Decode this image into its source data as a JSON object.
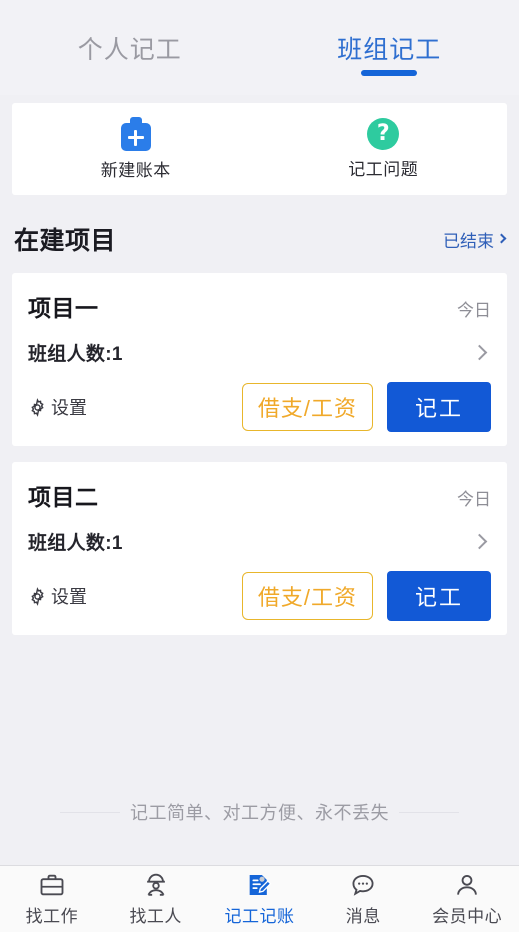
{
  "tabs": [
    {
      "label": "个人记工",
      "active": false,
      "name": "tab-personal"
    },
    {
      "label": "班组记工",
      "active": true,
      "name": "tab-team"
    }
  ],
  "shortcuts": [
    {
      "label": "新建账本",
      "icon": "clipboard-plus-icon",
      "color": "#2b7de9"
    },
    {
      "label": "记工问题",
      "icon": "question-circle-icon",
      "color": "#2ecb9f"
    }
  ],
  "section": {
    "title": "在建项目",
    "link_label": "已结束",
    "link_color": "#2f5fb8"
  },
  "projects": [
    {
      "name": "项目一",
      "date": "今日",
      "members_label": "班组人数:1",
      "settings_label": "设置",
      "loan_button": "借支/工资",
      "record_button": "记工"
    },
    {
      "name": "项目二",
      "date": "今日",
      "members_label": "班组人数:1",
      "settings_label": "设置",
      "loan_button": "借支/工资",
      "record_button": "记工"
    }
  ],
  "tagline": "记工简单、对工方便、永不丢失",
  "bottom_nav": [
    {
      "label": "找工作",
      "icon": "briefcase-icon",
      "active": false
    },
    {
      "label": "找工人",
      "icon": "worker-helmet-icon",
      "active": false
    },
    {
      "label": "记工记账",
      "icon": "note-pencil-icon",
      "active": true
    },
    {
      "label": "消息",
      "icon": "chat-bubble-icon",
      "active": false
    },
    {
      "label": "会员中心",
      "icon": "person-icon",
      "active": false
    }
  ],
  "colors": {
    "background": "#f0f0f4",
    "card": "#ffffff",
    "primary_blue": "#1259d6",
    "accent_orange": "#f0a92a",
    "green": "#2ecb9f",
    "muted_text": "#9a9aa2"
  }
}
